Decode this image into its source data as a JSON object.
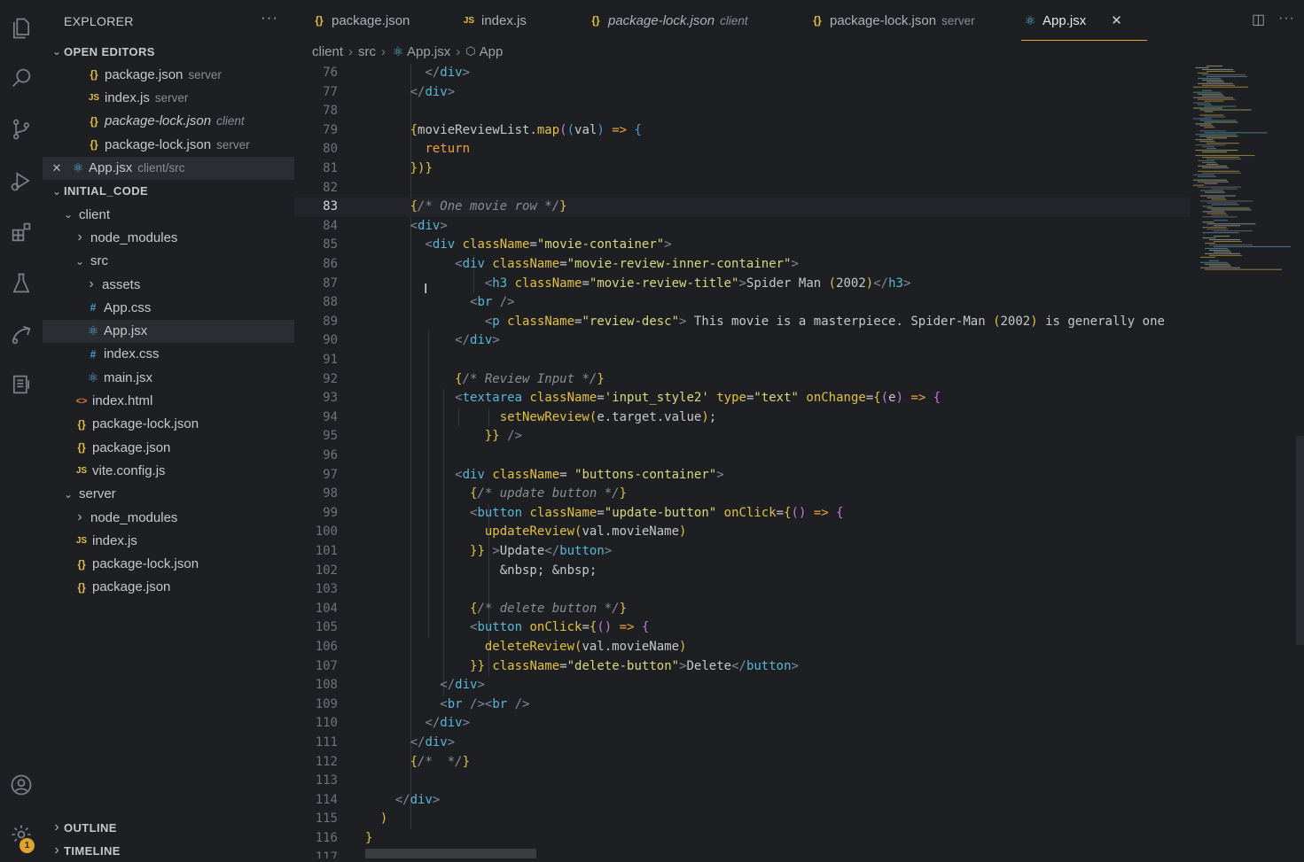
{
  "activity_bar": {
    "icons": [
      "files-icon",
      "search-icon",
      "source-control-icon",
      "run-debug-icon",
      "extensions-icon",
      "testing-icon",
      "remote-explorer-icon",
      "docker-icon",
      "accounts-icon",
      "settings-gear-icon"
    ],
    "settings_badge": "1"
  },
  "sidebar": {
    "title": "EXPLORER",
    "more_label": "···",
    "open_editors": {
      "label": "OPEN EDITORS",
      "items": [
        {
          "name": "package.json",
          "desc": "server",
          "type": "json",
          "italic": false
        },
        {
          "name": "index.js",
          "desc": "server",
          "type": "js",
          "italic": false
        },
        {
          "name": "package-lock.json",
          "desc": "client",
          "type": "json",
          "italic": true
        },
        {
          "name": "package-lock.json",
          "desc": "server",
          "type": "json",
          "italic": false
        },
        {
          "name": "App.jsx",
          "desc": "client/src",
          "type": "react",
          "italic": false
        }
      ]
    },
    "workspace": {
      "label": "INITIAL_CODE",
      "tree": [
        {
          "name": "client",
          "kind": "folder-open",
          "depth": 1
        },
        {
          "name": "node_modules",
          "kind": "folder",
          "depth": 2
        },
        {
          "name": "src",
          "kind": "folder-open",
          "depth": 2
        },
        {
          "name": "assets",
          "kind": "folder",
          "depth": 3
        },
        {
          "name": "App.css",
          "kind": "css",
          "depth": 3
        },
        {
          "name": "App.jsx",
          "kind": "react",
          "depth": 3
        },
        {
          "name": "index.css",
          "kind": "css",
          "depth": 3
        },
        {
          "name": "main.jsx",
          "kind": "react",
          "depth": 3
        },
        {
          "name": "index.html",
          "kind": "html",
          "depth": 2
        },
        {
          "name": "package-lock.json",
          "kind": "json",
          "depth": 2
        },
        {
          "name": "package.json",
          "kind": "json",
          "depth": 2
        },
        {
          "name": "vite.config.js",
          "kind": "js",
          "depth": 2
        },
        {
          "name": "server",
          "kind": "folder-open",
          "depth": 1
        },
        {
          "name": "node_modules",
          "kind": "folder",
          "depth": 2
        },
        {
          "name": "index.js",
          "kind": "js",
          "depth": 2
        },
        {
          "name": "package-lock.json",
          "kind": "json",
          "depth": 2
        },
        {
          "name": "package.json",
          "kind": "json",
          "depth": 2
        }
      ]
    },
    "outline_label": "OUTLINE",
    "timeline_label": "TIMELINE"
  },
  "tabs": [
    {
      "name": "package.json",
      "desc": "",
      "type": "json",
      "italic": false
    },
    {
      "name": "index.js",
      "desc": "",
      "type": "js",
      "italic": false
    },
    {
      "name": "package-lock.json",
      "desc": "client",
      "type": "json",
      "italic": true
    },
    {
      "name": "package-lock.json",
      "desc": "server",
      "type": "json",
      "italic": false
    },
    {
      "name": "App.jsx",
      "desc": "",
      "type": "react",
      "italic": false,
      "active": true
    }
  ],
  "tab_close_glyph": "✕",
  "breadcrumb": {
    "parts": [
      "client",
      "src",
      "App.jsx",
      "App"
    ]
  },
  "editor": {
    "current_line": 83,
    "lines": [
      {
        "n": "76",
        "t": "        </div>"
      },
      {
        "n": "77",
        "t": "      </div>"
      },
      {
        "n": "78",
        "t": ""
      },
      {
        "n": "79",
        "t": "      {movieReviewList.map((val) => {"
      },
      {
        "n": "80",
        "t": "        return"
      },
      {
        "n": "81",
        "t": "      })}"
      },
      {
        "n": "82",
        "t": ""
      },
      {
        "n": "83",
        "t": "      {/* One movie row */}"
      },
      {
        "n": "84",
        "t": "      <div>"
      },
      {
        "n": "85",
        "t": "        <div className=\"movie-container\">"
      },
      {
        "n": "86",
        "t": "            <div className=\"movie-review-inner-container\">"
      },
      {
        "n": "87",
        "t": "                <h3 className=\"movie-review-title\">Spider Man (2002)</h3>"
      },
      {
        "n": "88",
        "t": "              <br />"
      },
      {
        "n": "89",
        "t": "                <p className=\"review-desc\"> This movie is a masterpiece. Spider-Man (2002) is generally one"
      },
      {
        "n": "90",
        "t": "            </div>"
      },
      {
        "n": "91",
        "t": ""
      },
      {
        "n": "92",
        "t": "            {/* Review Input */}"
      },
      {
        "n": "93",
        "t": "            <textarea className='input_style2' type=\"text\" onChange={(e) => {"
      },
      {
        "n": "94",
        "t": "                  setNewReview(e.target.value);"
      },
      {
        "n": "95",
        "t": "                }} />"
      },
      {
        "n": "96",
        "t": ""
      },
      {
        "n": "97",
        "t": "            <div className= \"buttons-container\">"
      },
      {
        "n": "98",
        "t": "              {/* update button */}"
      },
      {
        "n": "99",
        "t": "              <button className=\"update-button\" onClick={() => {"
      },
      {
        "n": "100",
        "t": "                updateReview(val.movieName)"
      },
      {
        "n": "101",
        "t": "              }} >Update</button>"
      },
      {
        "n": "102",
        "t": "                  &nbsp; &nbsp;"
      },
      {
        "n": "103",
        "t": ""
      },
      {
        "n": "104",
        "t": "              {/* delete button */}"
      },
      {
        "n": "105",
        "t": "              <button onClick={() => {"
      },
      {
        "n": "106",
        "t": "                deleteReview(val.movieName)"
      },
      {
        "n": "107",
        "t": "              }} className=\"delete-button\">Delete</button>"
      },
      {
        "n": "108",
        "t": "          </div>"
      },
      {
        "n": "109",
        "t": "          <br /><br />"
      },
      {
        "n": "110",
        "t": "        </div>"
      },
      {
        "n": "111",
        "t": "      </div>"
      },
      {
        "n": "112",
        "t": "      {/*  */}"
      },
      {
        "n": "113",
        "t": ""
      },
      {
        "n": "114",
        "t": "    </div>"
      },
      {
        "n": "115",
        "t": "  )"
      },
      {
        "n": "116",
        "t": "}"
      },
      {
        "n": "117",
        "t": ""
      }
    ]
  }
}
